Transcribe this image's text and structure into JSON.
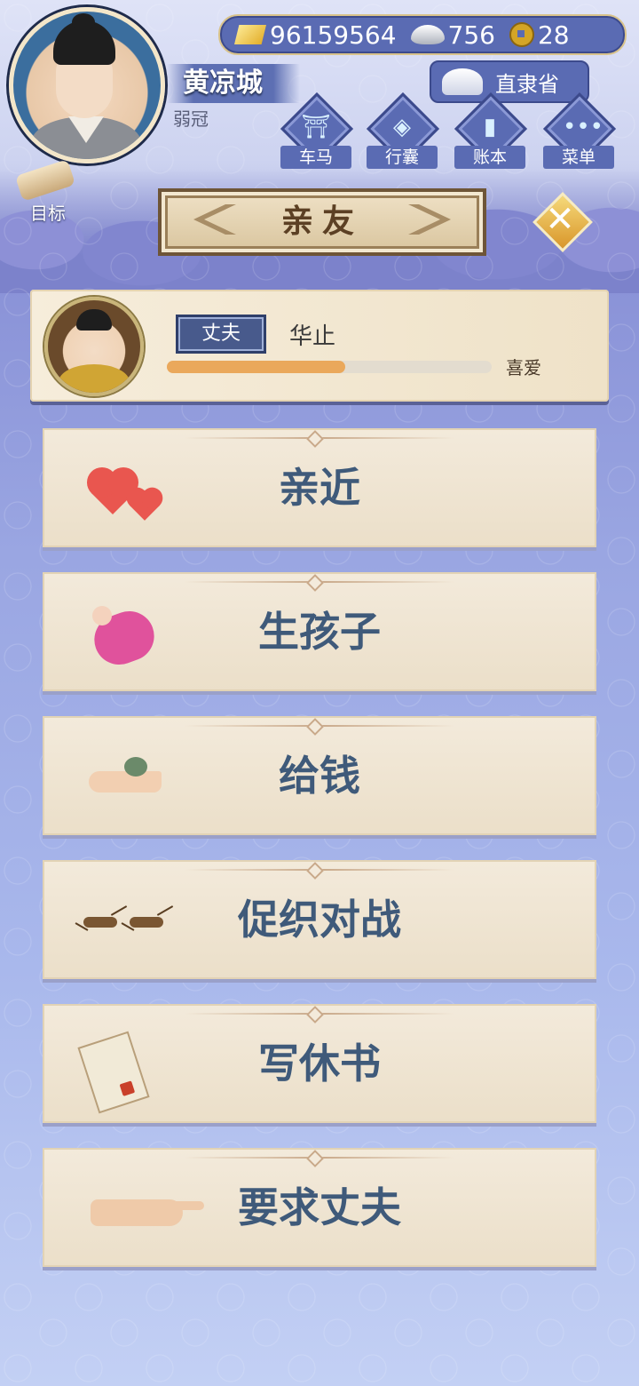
{
  "player": {
    "name": "黄凉城",
    "age_title": "弱冠"
  },
  "resources": {
    "gold": "96159564",
    "silver": "756",
    "coins": "28"
  },
  "location": "直隶省",
  "menu": [
    {
      "label": "车马",
      "icon": "carriage-icon"
    },
    {
      "label": "行囊",
      "icon": "bag-icon"
    },
    {
      "label": "账本",
      "icon": "ledger-icon"
    },
    {
      "label": "菜单",
      "icon": "more-icon"
    }
  ],
  "goal_label": "目标",
  "title": "亲友",
  "close_icon": "close-icon",
  "relative": {
    "tag": "丈夫",
    "name": "华止",
    "affection_label": "喜爱",
    "affection_level": 0.55
  },
  "actions": [
    {
      "label": "亲近",
      "icon": "hearts-icon"
    },
    {
      "label": "生孩子",
      "icon": "baby-icon"
    },
    {
      "label": "给钱",
      "icon": "money-hand-icon"
    },
    {
      "label": "促织对战",
      "icon": "cricket-icon"
    },
    {
      "label": "写休书",
      "icon": "divorce-letter-icon"
    },
    {
      "label": "要求丈夫",
      "icon": "pointing-hand-icon"
    }
  ],
  "colors": {
    "accent": "#5a6bb3",
    "affection_fill": "#eaa85b",
    "action_text": "#3f5a7a"
  }
}
